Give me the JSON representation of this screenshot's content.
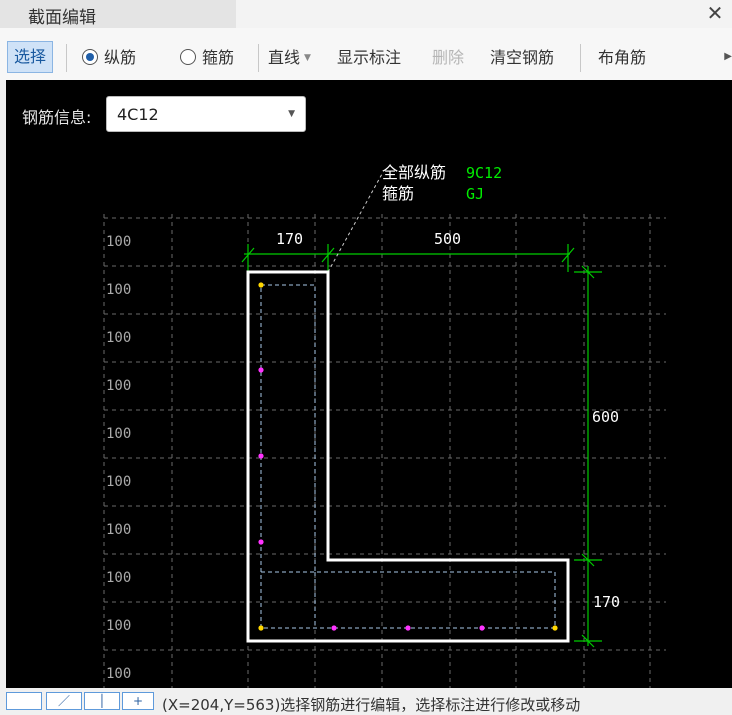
{
  "window": {
    "title": "截面编辑",
    "close_glyph": "✕"
  },
  "toolbar": {
    "select_label": "选择",
    "radio_longitudinal": "纵筋",
    "radio_stirrup": "箍筋",
    "line_type": "直线",
    "show_annotation": "显示标注",
    "delete": "删除",
    "clear_rebar": "清空钢筋",
    "corner_rebar": "布角筋"
  },
  "rebar_info": {
    "label": "钢筋信息:",
    "value": "4C12"
  },
  "drawing": {
    "all_longitudinal_label": "全部纵筋",
    "all_longitudinal_value": "9C12",
    "stirrup_label": "箍筋",
    "stirrup_value": "GJ",
    "dim_top_left": "170",
    "dim_top_right": "500",
    "dim_right_top": "600",
    "dim_right_bottom": "170",
    "grid_labels": [
      "100",
      "100",
      "100",
      "100",
      "100",
      "100",
      "100",
      "100",
      "100",
      "100"
    ],
    "colors": {
      "outline": "#ffffff",
      "dimension": "#00cc00",
      "grid": "#6a6a6a",
      "stirrup": "#a8c8e8",
      "corner_bar": "#ffd700",
      "mid_bar": "#ff33ff"
    }
  },
  "statusbar": {
    "text": "(X=204,Y=563)选择钢筋进行编辑，选择标注进行修改或移动"
  }
}
